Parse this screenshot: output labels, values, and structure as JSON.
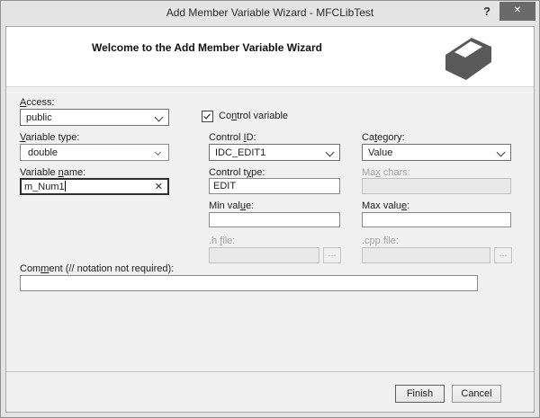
{
  "window": {
    "title": "Add Member Variable Wizard - MFCLibTest",
    "help_glyph": "?",
    "close_glyph": "✕"
  },
  "colors": {
    "close_button_bg": "#6a6a6a",
    "icon_gray": "#595959",
    "client_bg": "#f0f0f0",
    "header_bg": "#ffffff",
    "focused_border": "#2e2e2e"
  },
  "header": {
    "title": "Welcome to the Add Member Variable Wizard"
  },
  "fields": {
    "access": {
      "label": {
        "pre": "",
        "key": "A",
        "post": "ccess:"
      },
      "value": "public"
    },
    "variable_type": {
      "label": {
        "pre": "",
        "key": "V",
        "post": "ariable type:"
      },
      "value": "double"
    },
    "variable_name": {
      "label": {
        "pre": "Variable ",
        "key": "n",
        "post": "ame:"
      },
      "value": "m_Num1",
      "clear_glyph": "✕"
    },
    "control_variable": {
      "label": {
        "pre": "Co",
        "key": "n",
        "post": "trol variable"
      },
      "checked": true
    },
    "control_id": {
      "label": {
        "pre": "Control ",
        "key": "I",
        "post": "D:"
      },
      "value": "IDC_EDIT1"
    },
    "control_type": {
      "label": {
        "pre": "Control t",
        "key": "y",
        "post": "pe:"
      },
      "value": "EDIT"
    },
    "category": {
      "label": {
        "pre": "Ca",
        "key": "t",
        "post": "egory:"
      },
      "value": "Value"
    },
    "max_chars": {
      "label": {
        "pre": "Ma",
        "key": "x",
        "post": " chars:"
      },
      "value": "",
      "disabled": true
    },
    "min_value": {
      "label": {
        "pre": "Min val",
        "key": "u",
        "post": "e:"
      },
      "value": ""
    },
    "max_value": {
      "label": {
        "pre": "Max valu",
        "key": "e",
        "post": ":"
      },
      "value": ""
    },
    "h_file": {
      "label": {
        "pre": ".h ",
        "key": "f",
        "post": "ile:"
      },
      "value": "",
      "disabled": true,
      "browse_label": "..."
    },
    "cpp_file": {
      "label": {
        "pre": ".cpp file:",
        "key": "",
        "post": ""
      },
      "value": "",
      "disabled": true,
      "browse_label": "..."
    },
    "comment": {
      "label": {
        "pre": "Com",
        "key": "m",
        "post": "ent (// notation not required):"
      },
      "value": ""
    }
  },
  "buttons": {
    "finish": "Finish",
    "cancel": "Cancel"
  }
}
